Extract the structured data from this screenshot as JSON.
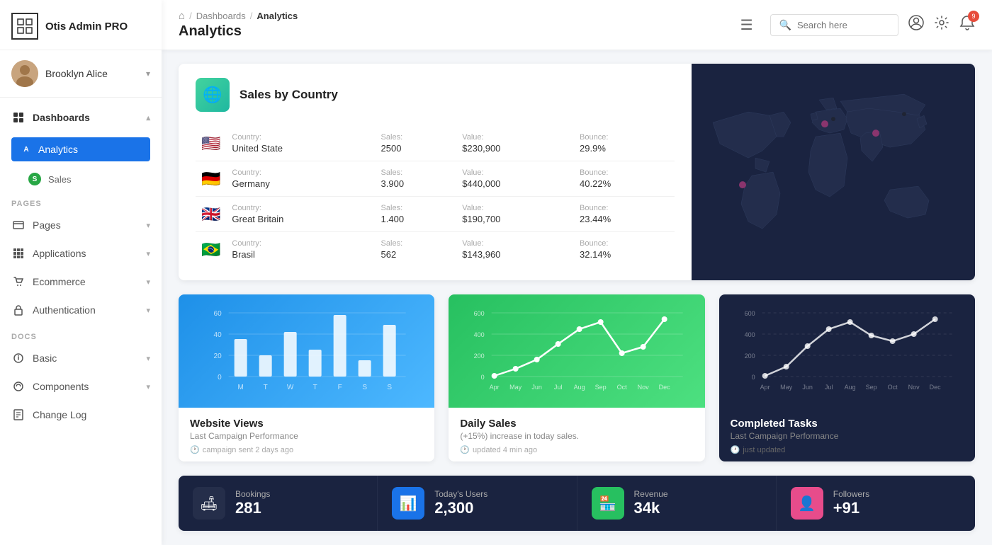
{
  "sidebar": {
    "logo": {
      "icon": "⊞",
      "text": "Otis Admin PRO"
    },
    "user": {
      "name": "Brooklyn Alice",
      "avatar_char": "👩"
    },
    "dashboards_label": "Dashboards",
    "analytics_label": "Analytics",
    "sales_label": "Sales",
    "pages_section": "PAGES",
    "pages_label": "Pages",
    "applications_label": "Applications",
    "ecommerce_label": "Ecommerce",
    "authentication_label": "Authentication",
    "docs_section": "DOCS",
    "basic_label": "Basic",
    "components_label": "Components",
    "changelog_label": "Change Log"
  },
  "header": {
    "home_icon": "⌂",
    "breadcrumb_dashboards": "Dashboards",
    "breadcrumb_analytics": "Analytics",
    "page_title": "Analytics",
    "menu_icon": "☰",
    "search_placeholder": "Search here",
    "notification_count": "9"
  },
  "sales_by_country": {
    "title": "Sales by Country",
    "countries": [
      {
        "flag": "🇺🇸",
        "country_label": "Country:",
        "country_name": "United State",
        "sales_label": "Sales:",
        "sales_value": "2500",
        "value_label": "Value:",
        "value_amount": "$230,900",
        "bounce_label": "Bounce:",
        "bounce_pct": "29.9%"
      },
      {
        "flag": "🇩🇪",
        "country_label": "Country:",
        "country_name": "Germany",
        "sales_label": "Sales:",
        "sales_value": "3.900",
        "value_label": "Value:",
        "value_amount": "$440,000",
        "bounce_label": "Bounce:",
        "bounce_pct": "40.22%"
      },
      {
        "flag": "🇬🇧",
        "country_label": "Country:",
        "country_name": "Great Britain",
        "sales_label": "Sales:",
        "sales_value": "1.400",
        "value_label": "Value:",
        "value_amount": "$190,700",
        "bounce_label": "Bounce:",
        "bounce_pct": "23.44%"
      },
      {
        "flag": "🇧🇷",
        "country_label": "Country:",
        "country_name": "Brasil",
        "sales_label": "Sales:",
        "sales_value": "562",
        "value_label": "Value:",
        "value_amount": "$143,960",
        "bounce_label": "Bounce:",
        "bounce_pct": "32.14%"
      }
    ]
  },
  "website_views": {
    "title": "Website Views",
    "subtitle": "Last Campaign Performance",
    "footer": "campaign sent 2 days ago",
    "y_labels": [
      "0",
      "20",
      "40",
      "60"
    ],
    "x_labels": [
      "M",
      "T",
      "W",
      "T",
      "F",
      "S",
      "S"
    ],
    "bars": [
      35,
      20,
      42,
      25,
      58,
      15,
      48
    ]
  },
  "daily_sales": {
    "title": "Daily Sales",
    "subtitle": "(+15%) increase in today sales.",
    "footer": "updated 4 min ago",
    "y_labels": [
      "0",
      "200",
      "400",
      "600"
    ],
    "x_labels": [
      "Apr",
      "May",
      "Jun",
      "Jul",
      "Aug",
      "Sep",
      "Oct",
      "Nov",
      "Dec"
    ],
    "points": [
      5,
      60,
      140,
      280,
      420,
      480,
      200,
      260,
      500
    ]
  },
  "completed_tasks": {
    "title": "Completed Tasks",
    "subtitle": "Last Campaign Performance",
    "footer": "just updated",
    "y_labels": [
      "0",
      "200",
      "400",
      "600"
    ],
    "x_labels": [
      "Apr",
      "May",
      "Jun",
      "Jul",
      "Aug",
      "Sep",
      "Oct",
      "Nov",
      "Dec"
    ],
    "points": [
      10,
      80,
      260,
      400,
      480,
      350,
      300,
      360,
      500
    ]
  },
  "stats": [
    {
      "icon": "🛋",
      "icon_style": "dark",
      "label": "Bookings",
      "value": "281"
    },
    {
      "icon": "📊",
      "icon_style": "blue",
      "label": "Today's Users",
      "value": "2,300"
    },
    {
      "icon": "🏪",
      "icon_style": "green",
      "label": "Revenue",
      "value": "34k"
    },
    {
      "icon": "👤",
      "icon_style": "pink",
      "label": "Followers",
      "value": "+91"
    }
  ]
}
